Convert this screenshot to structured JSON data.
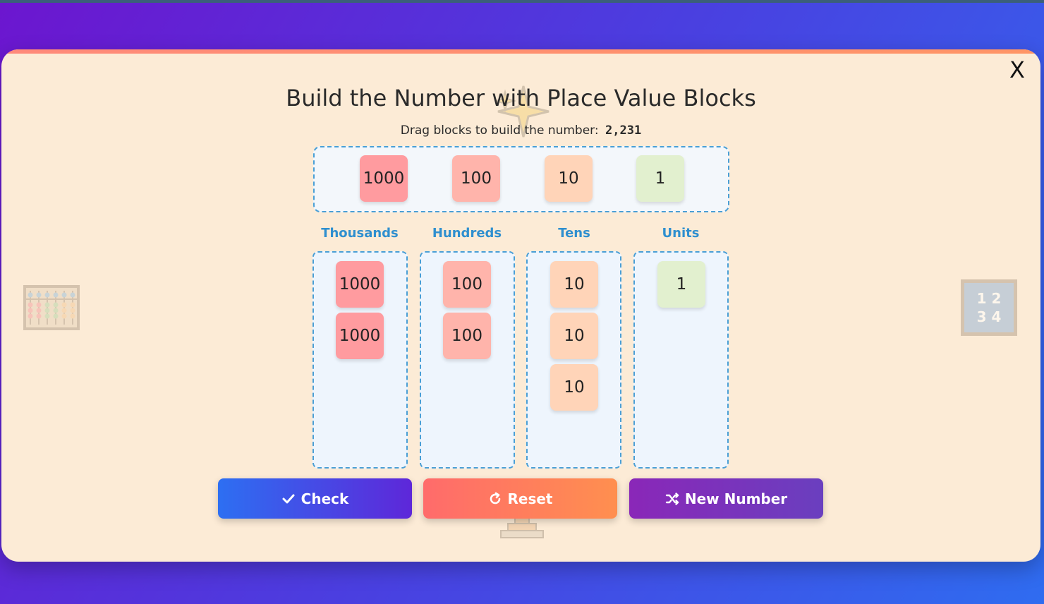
{
  "modal": {
    "close_label": "X",
    "title": "Build the Number with Place Value Blocks",
    "subtitle_prefix": "Drag blocks to build the number:",
    "target_number": "2,231"
  },
  "palette": {
    "blocks": [
      "1000",
      "100",
      "10",
      "1"
    ]
  },
  "columns": [
    {
      "label": "Thousands",
      "blocks": [
        "1000",
        "1000"
      ]
    },
    {
      "label": "Hundreds",
      "blocks": [
        "100",
        "100"
      ]
    },
    {
      "label": "Tens",
      "blocks": [
        "10",
        "10",
        "10"
      ]
    },
    {
      "label": "Units",
      "blocks": [
        "1"
      ]
    }
  ],
  "buttons": {
    "check": "Check",
    "reset": "Reset",
    "new_number": "New Number"
  },
  "decor": {
    "numbers_icon_text": [
      "1 2",
      "3 4"
    ]
  },
  "colors": {
    "thousands": "#ff9b9f",
    "hundreds": "#ffb4ab",
    "tens": "#ffd4b8",
    "units": "#e2f0cf",
    "accent": "#4a9fd6"
  }
}
